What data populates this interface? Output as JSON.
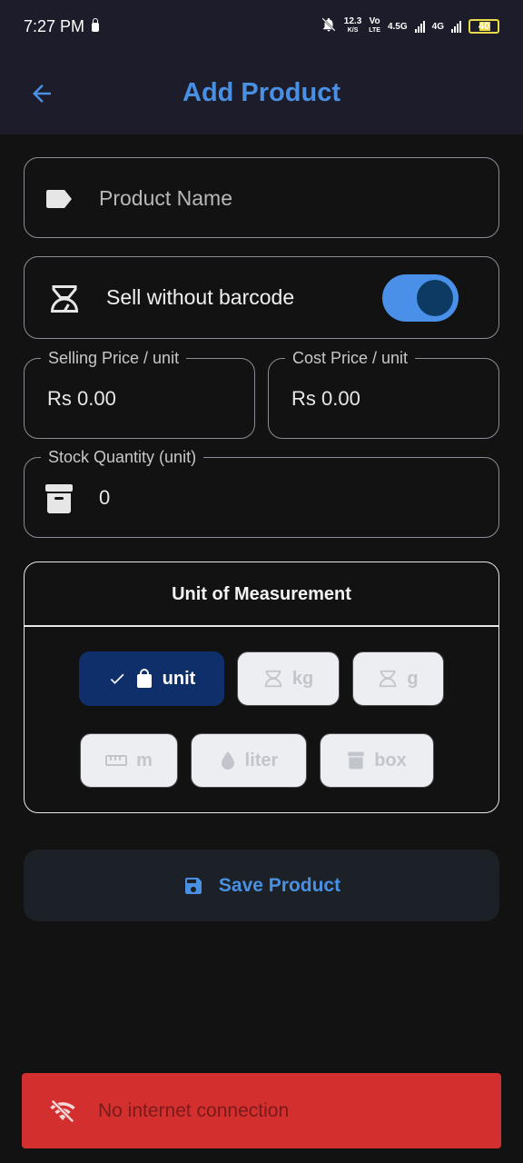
{
  "status_bar": {
    "time": "7:27 PM",
    "net_speed": "12.3",
    "net_speed_unit": "K/S",
    "volte_top": "Vo",
    "volte_bottom": "LTE",
    "network_1": "4.5G",
    "network_2": "4G",
    "battery": "40"
  },
  "app_bar": {
    "title": "Add Product"
  },
  "form": {
    "product_name_placeholder": "Product Name",
    "sell_without_barcode_label": "Sell without barcode",
    "sell_without_barcode_on": true,
    "selling_price_label": "Selling Price / unit",
    "selling_price_value": "Rs 0.00",
    "cost_price_label": "Cost Price / unit",
    "cost_price_value": "Rs 0.00",
    "stock_label": "Stock Quantity (unit)",
    "stock_value": "0"
  },
  "uom": {
    "title": "Unit of Measurement",
    "options": [
      {
        "label": "unit",
        "icon": "shopping-bag-icon",
        "selected": true
      },
      {
        "label": "kg",
        "icon": "scale-icon",
        "selected": false
      },
      {
        "label": "g",
        "icon": "scale-icon",
        "selected": false
      },
      {
        "label": "m",
        "icon": "ruler-icon",
        "selected": false
      },
      {
        "label": "liter",
        "icon": "water-drop-icon",
        "selected": false
      },
      {
        "label": "box",
        "icon": "archive-icon",
        "selected": false
      }
    ]
  },
  "save_button": {
    "label": "Save Product"
  },
  "snackbar": {
    "message": "No internet connection"
  },
  "colors": {
    "accent": "#4a90e2",
    "background": "#121212",
    "appbar": "#1c1c2a",
    "selected_chip": "#0f2f6b",
    "snackbar": "#d32f2f"
  }
}
